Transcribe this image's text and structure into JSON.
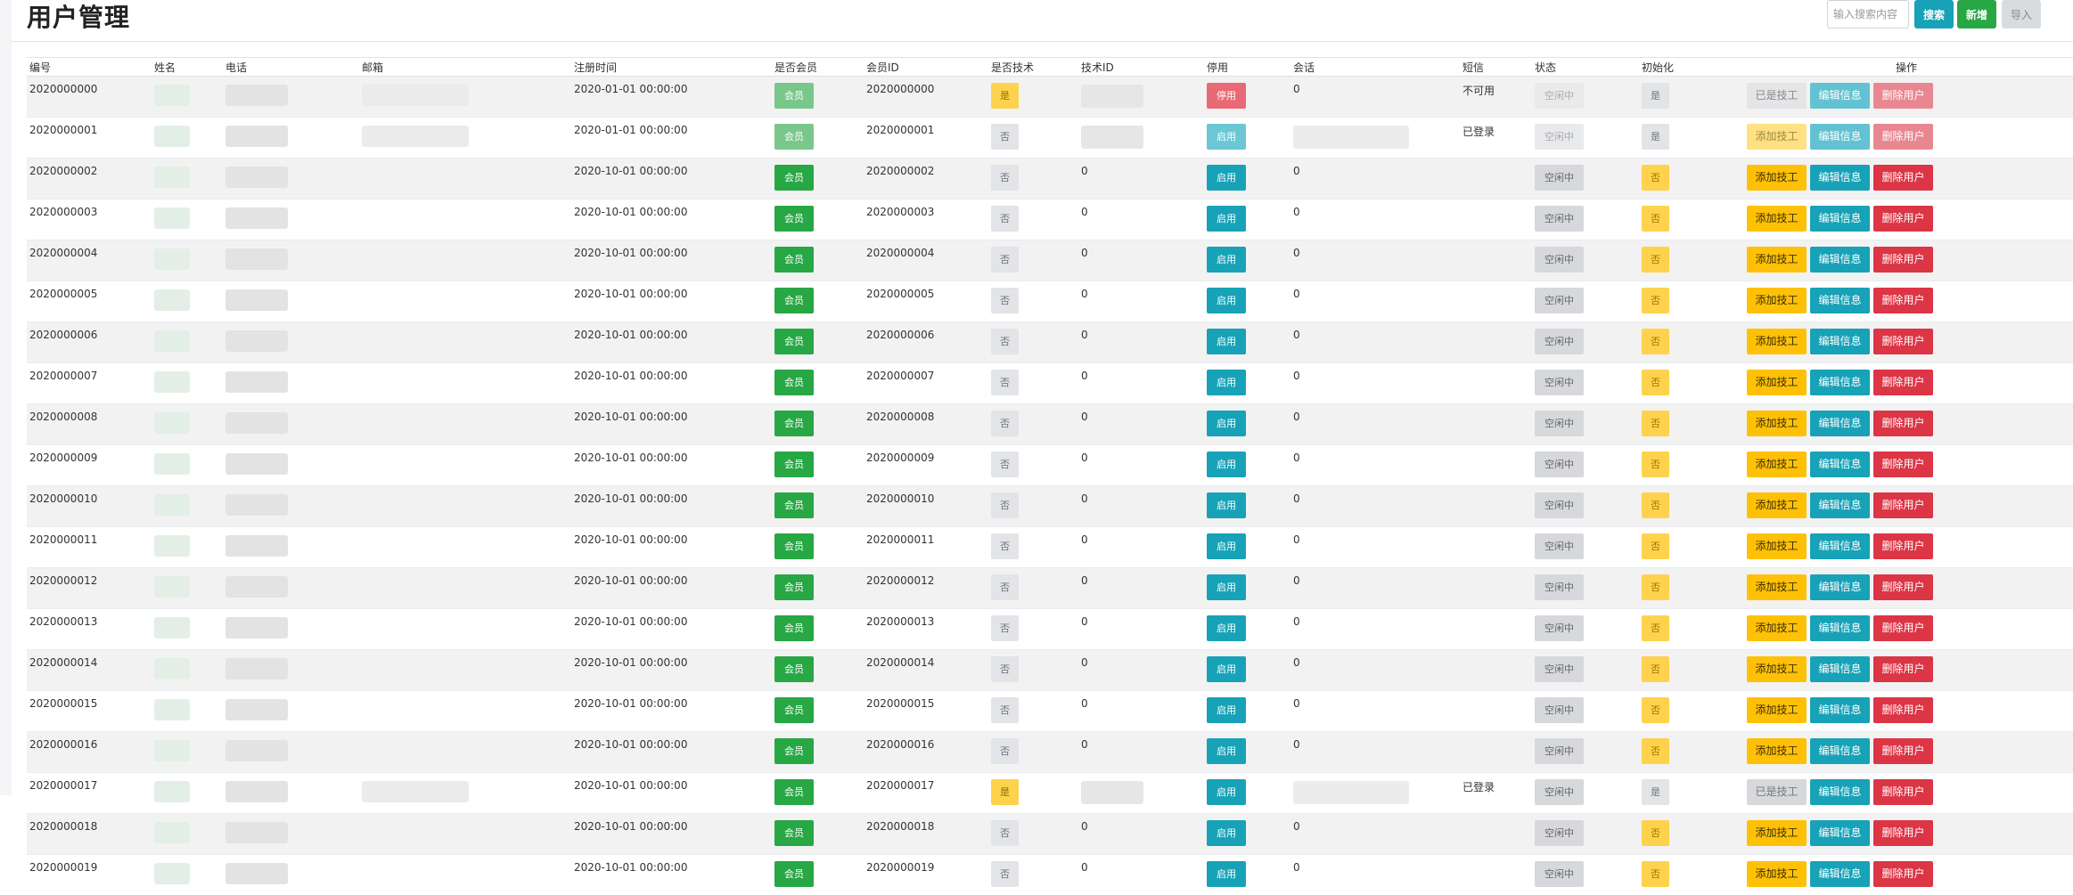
{
  "page": {
    "title": "用户管理",
    "search_placeholder": "输入搜索内容",
    "search_button": "搜索",
    "add_button": "新增",
    "import_button": "导入"
  },
  "columns": [
    "编号",
    "姓名",
    "电话",
    "邮箱",
    "注册时间",
    "是否会员",
    "会员ID",
    "是否技术",
    "技术ID",
    "停用",
    "会话",
    "短信",
    "状态",
    "初始化",
    "操作"
  ],
  "rows": [
    {
      "id": "2020000000",
      "reg": "2020-01-01 00:00:00",
      "member": "会员",
      "member_id": "2020000000",
      "tech": "是",
      "tech_id": "",
      "stop": "停用",
      "session": "0",
      "sms": "不可用",
      "status": "空闲中",
      "init": "是",
      "act1": "已是技工",
      "act2": "编辑信息",
      "act3": "删除用户"
    },
    {
      "id": "2020000001",
      "reg": "2020-01-01 00:00:00",
      "member": "会员",
      "member_id": "2020000001",
      "tech": "否",
      "tech_id": "",
      "stop": "启用",
      "session": "",
      "sms": "已登录",
      "status": "空闲中",
      "init": "是",
      "act1": "添加技工",
      "act2": "编辑信息",
      "act3": "删除用户"
    },
    {
      "id": "2020000002",
      "reg": "2020-10-01 00:00:00",
      "member": "会员",
      "member_id": "2020000002",
      "tech": "否",
      "tech_id": "0",
      "stop": "启用",
      "session": "0",
      "sms": "",
      "status": "空闲中",
      "init": "否",
      "act1": "添加技工",
      "act2": "编辑信息",
      "act3": "删除用户"
    },
    {
      "id": "2020000003",
      "reg": "2020-10-01 00:00:00",
      "member": "会员",
      "member_id": "2020000003",
      "tech": "否",
      "tech_id": "0",
      "stop": "启用",
      "session": "0",
      "sms": "",
      "status": "空闲中",
      "init": "否",
      "act1": "添加技工",
      "act2": "编辑信息",
      "act3": "删除用户"
    },
    {
      "id": "2020000004",
      "reg": "2020-10-01 00:00:00",
      "member": "会员",
      "member_id": "2020000004",
      "tech": "否",
      "tech_id": "0",
      "stop": "启用",
      "session": "0",
      "sms": "",
      "status": "空闲中",
      "init": "否",
      "act1": "添加技工",
      "act2": "编辑信息",
      "act3": "删除用户"
    },
    {
      "id": "2020000005",
      "reg": "2020-10-01 00:00:00",
      "member": "会员",
      "member_id": "2020000005",
      "tech": "否",
      "tech_id": "0",
      "stop": "启用",
      "session": "0",
      "sms": "",
      "status": "空闲中",
      "init": "否",
      "act1": "添加技工",
      "act2": "编辑信息",
      "act3": "删除用户"
    },
    {
      "id": "2020000006",
      "reg": "2020-10-01 00:00:00",
      "member": "会员",
      "member_id": "2020000006",
      "tech": "否",
      "tech_id": "0",
      "stop": "启用",
      "session": "0",
      "sms": "",
      "status": "空闲中",
      "init": "否",
      "act1": "添加技工",
      "act2": "编辑信息",
      "act3": "删除用户"
    },
    {
      "id": "2020000007",
      "reg": "2020-10-01 00:00:00",
      "member": "会员",
      "member_id": "2020000007",
      "tech": "否",
      "tech_id": "0",
      "stop": "启用",
      "session": "0",
      "sms": "",
      "status": "空闲中",
      "init": "否",
      "act1": "添加技工",
      "act2": "编辑信息",
      "act3": "删除用户"
    },
    {
      "id": "2020000008",
      "reg": "2020-10-01 00:00:00",
      "member": "会员",
      "member_id": "2020000008",
      "tech": "否",
      "tech_id": "0",
      "stop": "启用",
      "session": "0",
      "sms": "",
      "status": "空闲中",
      "init": "否",
      "act1": "添加技工",
      "act2": "编辑信息",
      "act3": "删除用户"
    },
    {
      "id": "2020000009",
      "reg": "2020-10-01 00:00:00",
      "member": "会员",
      "member_id": "2020000009",
      "tech": "否",
      "tech_id": "0",
      "stop": "启用",
      "session": "0",
      "sms": "",
      "status": "空闲中",
      "init": "否",
      "act1": "添加技工",
      "act2": "编辑信息",
      "act3": "删除用户"
    },
    {
      "id": "2020000010",
      "reg": "2020-10-01 00:00:00",
      "member": "会员",
      "member_id": "2020000010",
      "tech": "否",
      "tech_id": "0",
      "stop": "启用",
      "session": "0",
      "sms": "",
      "status": "空闲中",
      "init": "否",
      "act1": "添加技工",
      "act2": "编辑信息",
      "act3": "删除用户"
    },
    {
      "id": "2020000011",
      "reg": "2020-10-01 00:00:00",
      "member": "会员",
      "member_id": "2020000011",
      "tech": "否",
      "tech_id": "0",
      "stop": "启用",
      "session": "0",
      "sms": "",
      "status": "空闲中",
      "init": "否",
      "act1": "添加技工",
      "act2": "编辑信息",
      "act3": "删除用户"
    },
    {
      "id": "2020000012",
      "reg": "2020-10-01 00:00:00",
      "member": "会员",
      "member_id": "2020000012",
      "tech": "否",
      "tech_id": "0",
      "stop": "启用",
      "session": "0",
      "sms": "",
      "status": "空闲中",
      "init": "否",
      "act1": "添加技工",
      "act2": "编辑信息",
      "act3": "删除用户"
    },
    {
      "id": "2020000013",
      "reg": "2020-10-01 00:00:00",
      "member": "会员",
      "member_id": "2020000013",
      "tech": "否",
      "tech_id": "0",
      "stop": "启用",
      "session": "0",
      "sms": "",
      "status": "空闲中",
      "init": "否",
      "act1": "添加技工",
      "act2": "编辑信息",
      "act3": "删除用户"
    },
    {
      "id": "2020000014",
      "reg": "2020-10-01 00:00:00",
      "member": "会员",
      "member_id": "2020000014",
      "tech": "否",
      "tech_id": "0",
      "stop": "启用",
      "session": "0",
      "sms": "",
      "status": "空闲中",
      "init": "否",
      "act1": "添加技工",
      "act2": "编辑信息",
      "act3": "删除用户"
    },
    {
      "id": "2020000015",
      "reg": "2020-10-01 00:00:00",
      "member": "会员",
      "member_id": "2020000015",
      "tech": "否",
      "tech_id": "0",
      "stop": "启用",
      "session": "0",
      "sms": "",
      "status": "空闲中",
      "init": "否",
      "act1": "添加技工",
      "act2": "编辑信息",
      "act3": "删除用户"
    },
    {
      "id": "2020000016",
      "reg": "2020-10-01 00:00:00",
      "member": "会员",
      "member_id": "2020000016",
      "tech": "否",
      "tech_id": "0",
      "stop": "启用",
      "session": "0",
      "sms": "",
      "status": "空闲中",
      "init": "否",
      "act1": "添加技工",
      "act2": "编辑信息",
      "act3": "删除用户"
    },
    {
      "id": "2020000017",
      "reg": "2020-10-01 00:00:00",
      "member": "会员",
      "member_id": "2020000017",
      "tech": "是",
      "tech_id": "",
      "stop": "启用",
      "session": "",
      "sms": "已登录",
      "status": "空闲中",
      "init": "是",
      "act1": "已是技工",
      "act2": "编辑信息",
      "act3": "删除用户"
    },
    {
      "id": "2020000018",
      "reg": "2020-10-01 00:00:00",
      "member": "会员",
      "member_id": "2020000018",
      "tech": "否",
      "tech_id": "0",
      "stop": "启用",
      "session": "0",
      "sms": "",
      "status": "空闲中",
      "init": "否",
      "act1": "添加技工",
      "act2": "编辑信息",
      "act3": "删除用户"
    },
    {
      "id": "2020000019",
      "reg": "2020-10-01 00:00:00",
      "member": "会员",
      "member_id": "2020000019",
      "tech": "否",
      "tech_id": "0",
      "stop": "启用",
      "session": "0",
      "sms": "",
      "status": "空闲中",
      "init": "否",
      "act1": "添加技工",
      "act2": "编辑信息",
      "act3": "删除用户"
    }
  ]
}
